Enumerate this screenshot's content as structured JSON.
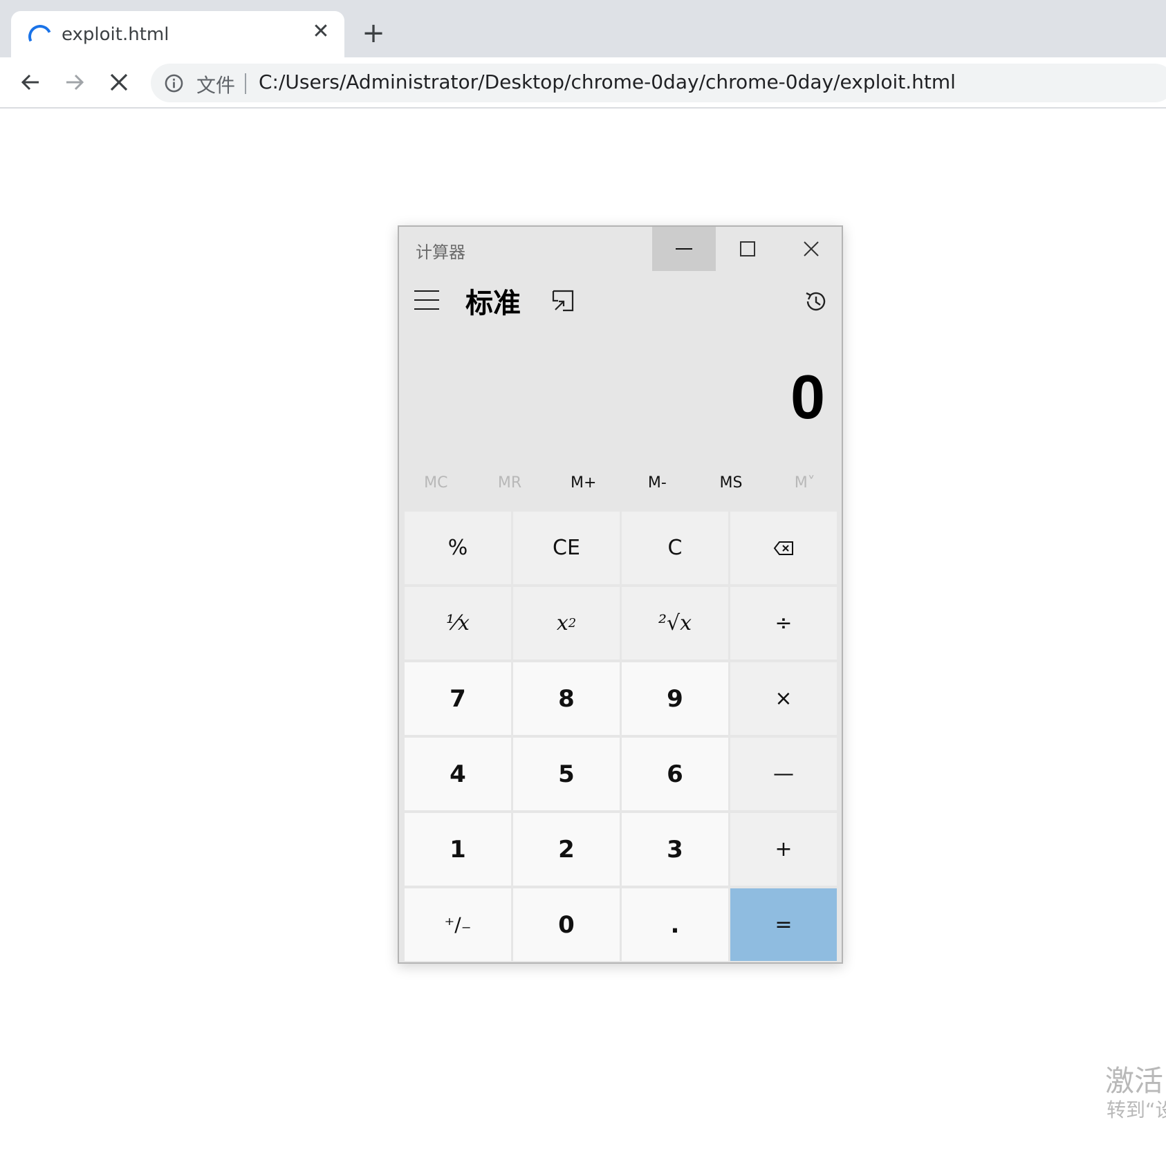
{
  "browser": {
    "tab_title": "exploit.html",
    "tab_close_glyph": "✕",
    "new_tab_glyph": "+",
    "scheme_chip": "文件",
    "url": "C:/Users/Administrator/Desktop/chrome-0day/chrome-0day/exploit.html",
    "icons": {
      "back": "back-arrow-icon",
      "forward": "forward-arrow-icon",
      "stop": "stop-loading-icon",
      "info": "info-icon",
      "spinner": "loading-spinner-icon"
    },
    "colors": {
      "tabstrip": "#dee1e6",
      "omnibox": "#f1f3f4",
      "spinner": "#1a73e8"
    }
  },
  "calculator": {
    "window_title": "计算器",
    "mode_title": "标准",
    "display_value": "0",
    "memory_buttons": [
      {
        "label": "MC",
        "enabled": false
      },
      {
        "label": "MR",
        "enabled": false
      },
      {
        "label": "M+",
        "enabled": true
      },
      {
        "label": "M-",
        "enabled": true
      },
      {
        "label": "MS",
        "enabled": true
      },
      {
        "label": "M˅",
        "enabled": false
      }
    ],
    "keys": {
      "percent": "%",
      "clear_entry": "CE",
      "clear": "C",
      "reciprocal": "¹⁄x",
      "square_base": "x",
      "square_exp": "2",
      "sqrt": "²√x",
      "divide": "÷",
      "seven": "7",
      "eight": "8",
      "nine": "9",
      "multiply": "×",
      "four": "4",
      "five": "5",
      "six": "6",
      "subtract": "—",
      "one": "1",
      "two": "2",
      "three": "3",
      "add": "+",
      "negate": "⁺∕₋",
      "zero": "0",
      "decimal": ".",
      "equals": "="
    },
    "colors": {
      "equals": "#8fbce0",
      "window": "#e6e6e6",
      "digit_key": "#f9f9f9",
      "op_key": "#f0f0f0"
    }
  },
  "watermark": {
    "title": "激活",
    "subtitle": "转到“设"
  }
}
